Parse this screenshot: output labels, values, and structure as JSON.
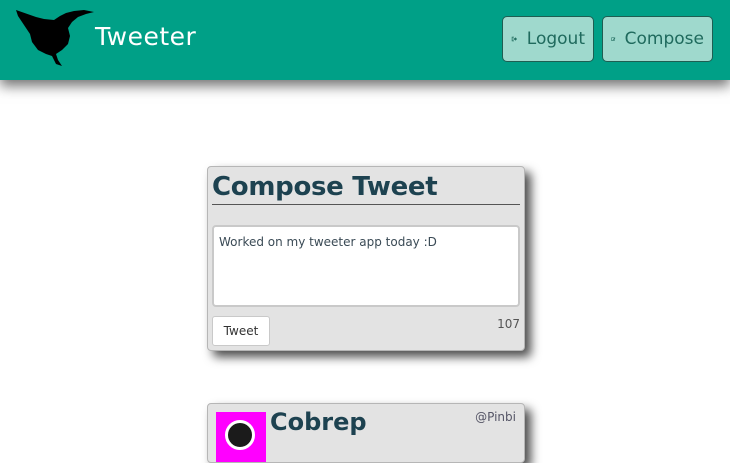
{
  "header": {
    "brand": "Tweeter",
    "logout_label": "Logout",
    "compose_label": "Compose"
  },
  "compose": {
    "title": "Compose Tweet",
    "text": "Worked on my tweeter app today :D",
    "tweet_label": "Tweet",
    "counter": "107"
  },
  "tweet": {
    "name": "Cobrep",
    "handle": "@Pinbi"
  },
  "colors": {
    "navbar": "#00a087",
    "nav_button": "#9fd9cd",
    "title": "#1d4250",
    "avatar_bg": "#ff00ff"
  },
  "icons": {
    "logo": "hummingbird-icon",
    "logout": "sign-out-icon",
    "compose": "pencil-square-icon"
  }
}
